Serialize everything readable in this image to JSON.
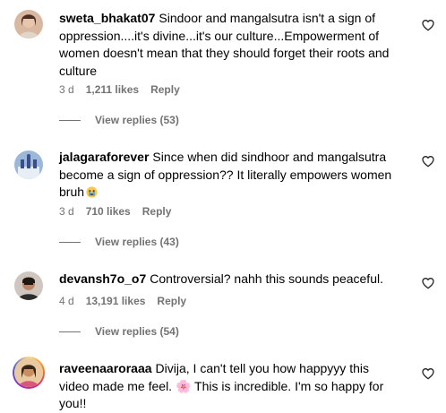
{
  "comments": [
    {
      "username": "sweta_bhakat07",
      "text": "Sindoor and mangalsutra isn't a sign of oppression....it's divine...it's our culture...Empowerment of women doesn't mean that they should forget their roots and culture",
      "age": "3 d",
      "likes": "1,211 likes",
      "reply": "Reply",
      "view_replies": "View replies (53)"
    },
    {
      "username": "jalagaraforever",
      "text": "Since when did sindhoor and mangalsutra become a sign of oppression?? It literally empowers women bruh",
      "emoji": "crying-face-emoji",
      "age": "3 d",
      "likes": "710 likes",
      "reply": "Reply",
      "view_replies": "View replies (43)"
    },
    {
      "username": "devansh7o_o7",
      "text": "Controversial? nahh this sounds peaceful.",
      "age": "4 d",
      "likes": "13,191 likes",
      "reply": "Reply",
      "view_replies": "View replies (54)"
    },
    {
      "username": "raveenaaroraaa",
      "text": "Divija, I can't tell you how happyyy this video made me feel. 🌸 This is incredible. I'm so happy for you!!"
    }
  ],
  "icons": {
    "like": "heart-outline-icon"
  }
}
